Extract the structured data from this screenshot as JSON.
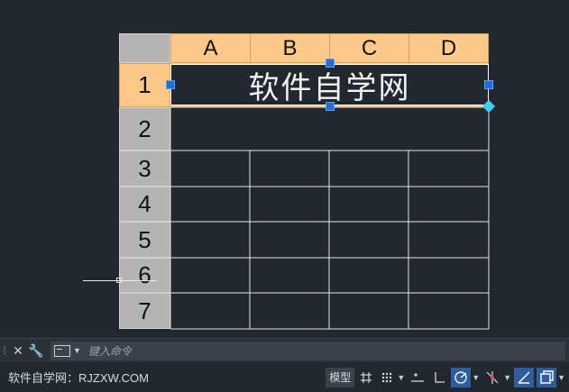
{
  "sheet": {
    "columns": [
      "A",
      "B",
      "C",
      "D"
    ],
    "rows": [
      "1",
      "2",
      "3",
      "4",
      "5",
      "6",
      "7"
    ],
    "title": "软件自学网",
    "selected_row": "1"
  },
  "command": {
    "placeholder": "键入命令"
  },
  "status": {
    "watermark": "软件自学网：RJZXW.COM",
    "model_label": "模型",
    "grid_icon": "grid-icon",
    "snap_icon": "snap-dots-icon",
    "ortho_icon": "ortho-icon",
    "polar_icon": "polar-tracking-icon",
    "osnap_icon": "object-snap-icon",
    "lineweight_icon": "lineweight-icon",
    "select_icon": "selection-cycle-icon"
  },
  "colors": {
    "canvas_bg": "#212830",
    "header_orange": "#fcc988",
    "header_gray": "#b4b4b4",
    "grip_blue": "#1e6fd9",
    "active_button": "#2e5f9c"
  }
}
